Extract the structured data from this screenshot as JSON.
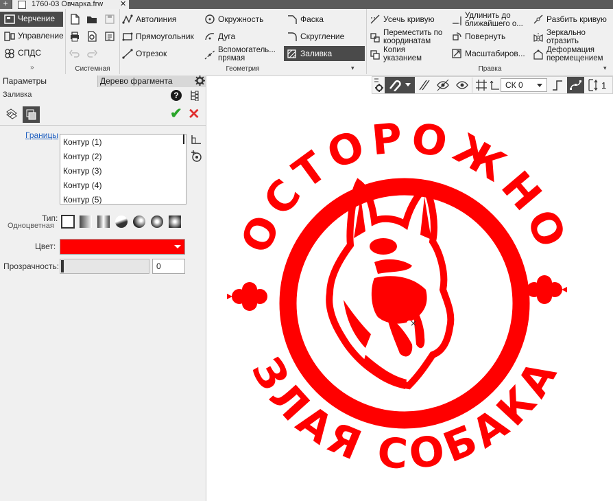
{
  "window": {
    "doc_tab_title": "1760-03 Овчарка.frw",
    "plus": "+",
    "close": "✕"
  },
  "ribbon": {
    "modes": [
      "Черчение",
      "Управление",
      "СПДС"
    ],
    "collapse_glyph": "»",
    "groups": {
      "system": "Системная",
      "geometry": "Геометрия",
      "edit": "Правка"
    },
    "geometry_items": {
      "autoline": "Автолиния",
      "circle": "Окружность",
      "chamfer": "Фаска",
      "rectangle": "Прямоугольник",
      "arc": "Дуга",
      "fillet": "Скругление",
      "segment": "Отрезок",
      "aux_line_1": "Вспомогатель...",
      "aux_line_2": "прямая",
      "fill": "Заливка"
    },
    "edit_items": {
      "trim": "Усечь кривую",
      "extend_1": "Удлинить до",
      "extend_2": "ближайшего о...",
      "split": "Разбить кривую",
      "move_1": "Переместить по",
      "move_2": "координатам",
      "rotate": "Повернуть",
      "mirror_1": "Зеркально",
      "mirror_2": "отразить",
      "copy_1": "Копия",
      "copy_2": "указанием",
      "scale": "Масштабиров...",
      "deform_1": "Деформация",
      "deform_2": "перемещением"
    },
    "accent_color": "#4a4a4a"
  },
  "panel": {
    "tab_params": "Параметры",
    "tab_tree": "Дерево фрагмента",
    "section_title": "Заливка",
    "help_glyph": "?",
    "ok_glyph": "✔",
    "cancel_glyph": "✕",
    "bounds_link": "Границы",
    "contours": [
      "Контур (1)",
      "Контур (2)",
      "Контур (3)",
      "Контур (4)",
      "Контур (5)"
    ],
    "type_label": "Тип:",
    "type_value": "Одноцветная",
    "color_label": "Цвет:",
    "color_value": "#ff0000",
    "transparency_label": "Прозрачность:",
    "transparency_value": "0"
  },
  "canvas_toolbar": {
    "cs_value": "СК 0",
    "count_value": "1"
  },
  "drawing": {
    "fill_color": "#ff0000",
    "top_text": "ОСТОРОЖНО",
    "bottom_text": "ЗЛАЯ СОБАКА",
    "cursor_mark": "×"
  }
}
